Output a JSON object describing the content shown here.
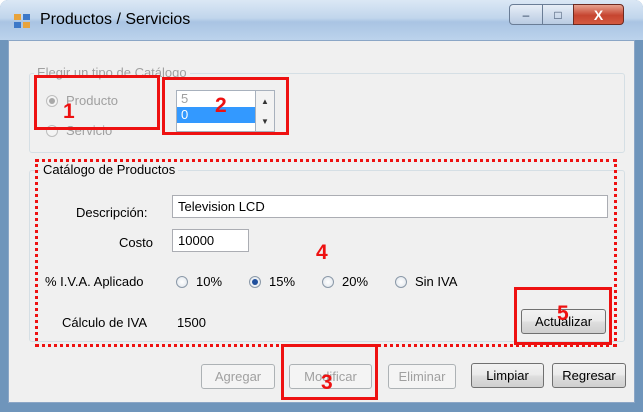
{
  "window": {
    "title": "Productos / Servicios",
    "controls": {
      "minimize": "–",
      "maximize": "□",
      "close": "X"
    }
  },
  "catalog_type": {
    "legend": "Elegir un tipo de Catálogo",
    "options": [
      {
        "label": "Producto",
        "selected": true
      },
      {
        "label": "Servicio",
        "selected": false
      }
    ],
    "list": [
      "5",
      "0"
    ],
    "selected_index": 1
  },
  "products": {
    "legend": "Catálogo de Productos",
    "description_label": "Descripción:",
    "description_value": "Television LCD",
    "cost_label": "Costo",
    "cost_value": "10000",
    "iva_label": "% I.V.A. Aplicado",
    "iva_options": [
      {
        "label": "10%",
        "selected": false
      },
      {
        "label": "15%",
        "selected": true
      },
      {
        "label": "20%",
        "selected": false
      },
      {
        "label": "Sin IVA",
        "selected": false
      }
    ],
    "iva_calc_label": "Cálculo de IVA",
    "iva_calc_value": "1500",
    "update_button": "Actualizar"
  },
  "buttons": {
    "add": "Agregar",
    "modify": "Modificar",
    "delete": "Eliminar",
    "clear": "Limpiar",
    "back": "Regresar"
  },
  "annotations": {
    "m1": "1",
    "m2": "2",
    "m3": "3",
    "m4": "4",
    "m5": "5"
  },
  "colors": {
    "annotation": "#ee1111",
    "selection": "#3399ff",
    "titlebar": "#c1d6ec"
  }
}
